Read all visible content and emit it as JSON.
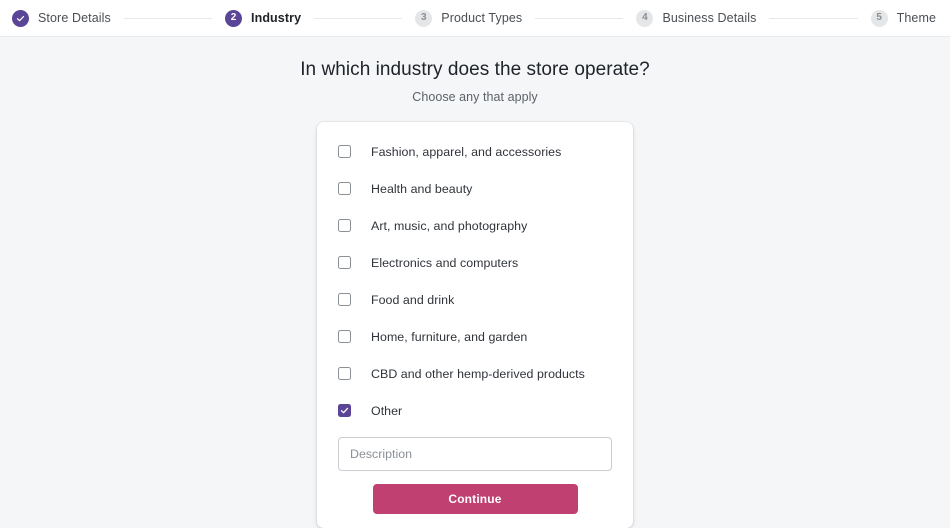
{
  "stepper": {
    "steps": [
      {
        "id": 1,
        "badge": "check-icon",
        "label": "Store Details",
        "state": "done"
      },
      {
        "id": 2,
        "badge": "2",
        "label": "Industry",
        "state": "current"
      },
      {
        "id": 3,
        "badge": "3",
        "label": "Product Types",
        "state": "upcoming"
      },
      {
        "id": 4,
        "badge": "4",
        "label": "Business Details",
        "state": "upcoming"
      },
      {
        "id": 5,
        "badge": "5",
        "label": "Theme",
        "state": "upcoming"
      }
    ]
  },
  "main": {
    "headline": "In which industry does the store operate?",
    "subhead": "Choose any that apply",
    "options": [
      {
        "label": "Fashion, apparel, and accessories",
        "checked": false
      },
      {
        "label": "Health and beauty",
        "checked": false
      },
      {
        "label": "Art, music, and photography",
        "checked": false
      },
      {
        "label": "Electronics and computers",
        "checked": false
      },
      {
        "label": "Food and drink",
        "checked": false
      },
      {
        "label": "Home, furniture, and garden",
        "checked": false
      },
      {
        "label": "CBD and other hemp-derived products",
        "checked": false
      },
      {
        "label": "Other",
        "checked": true
      }
    ],
    "description": {
      "placeholder": "Description",
      "value": ""
    },
    "continue_label": "Continue"
  },
  "colors": {
    "accent_purple": "#5b4597",
    "accent_raspberry": "#bf4071",
    "page_background": "#f5f6f7",
    "card_background": "#ffffff",
    "checkbox_border": "#8c9196"
  }
}
